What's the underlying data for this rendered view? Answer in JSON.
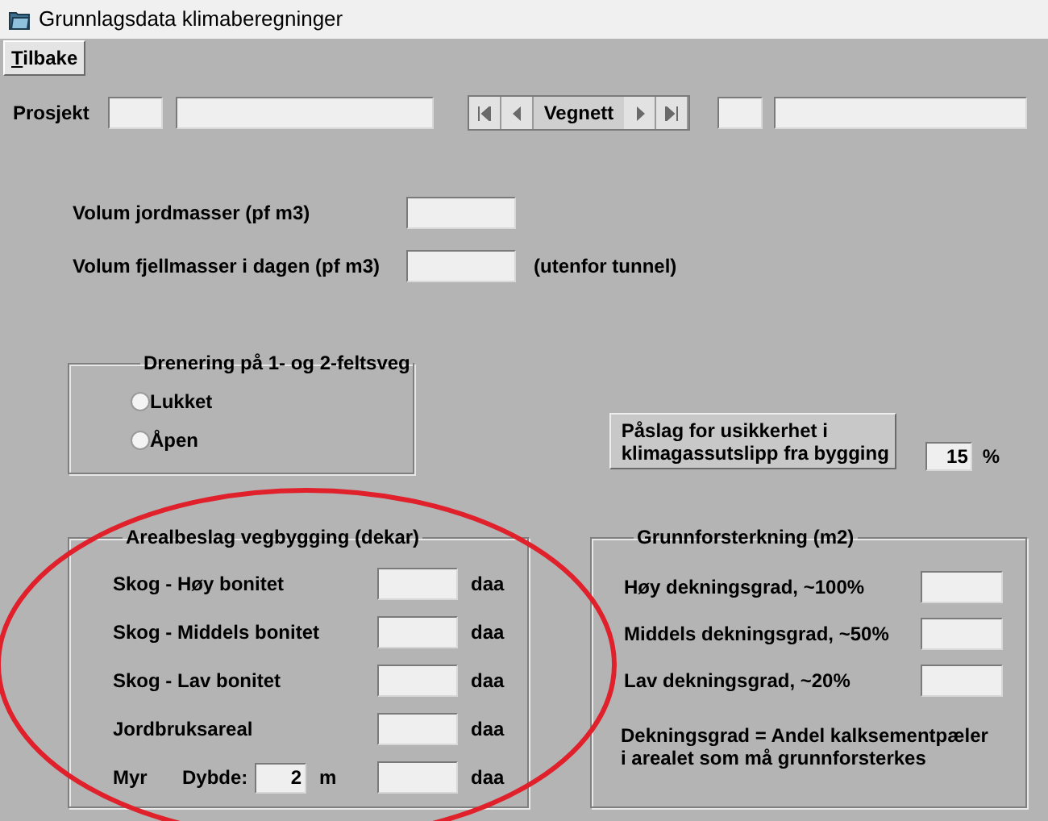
{
  "window": {
    "title": "Grunnlagsdata klimaberegninger"
  },
  "toolbar": {
    "back_button": "Tilbake"
  },
  "project": {
    "label": "Prosjekt",
    "navigator": "Vegnett"
  },
  "volumes": [
    {
      "label": "Volum jordmasser (pf m3)"
    },
    {
      "label": "Volum fjellmasser i dagen (pf m3)",
      "note": "(utenfor tunnel)"
    }
  ],
  "drainage": {
    "title": "Drenering på 1- og 2-feltsveg",
    "options": [
      {
        "label": "Lukket",
        "selected": false
      },
      {
        "label": "Åpen",
        "selected": false
      }
    ]
  },
  "uncertainty": {
    "button_lines": [
      "Påslag for usikkerhet i",
      "klimagassutslipp fra bygging"
    ],
    "value": "15",
    "unit": "%"
  },
  "area": {
    "title": "Arealbeslag vegbygging (dekar)",
    "rows": [
      {
        "kind": "plain",
        "label": "Skog - Høy bonitet",
        "unit": "daa"
      },
      {
        "kind": "plain",
        "label": "Skog - Middels bonitet",
        "unit": "daa"
      },
      {
        "kind": "plain",
        "label": "Skog - Lav bonitet",
        "unit": "daa"
      },
      {
        "kind": "plain",
        "label": "Jordbruksareal",
        "unit": "daa"
      },
      {
        "kind": "depth",
        "label": "Myr",
        "depth_label": "Dybde:",
        "depth_value": "2",
        "depth_unit": "m",
        "unit": "daa"
      }
    ]
  },
  "reinforcement": {
    "title": "Grunnforsterkning (m2)",
    "rows": [
      {
        "label": "Høy dekningsgrad, ~100%"
      },
      {
        "label": "Middels dekningsgrad, ~50%"
      },
      {
        "label": "Lav dekningsgrad, ~20%"
      }
    ],
    "note_lines": [
      "Dekningsgrad = Andel kalksementpæler",
      "i arealet som må grunnforsterkes"
    ]
  }
}
